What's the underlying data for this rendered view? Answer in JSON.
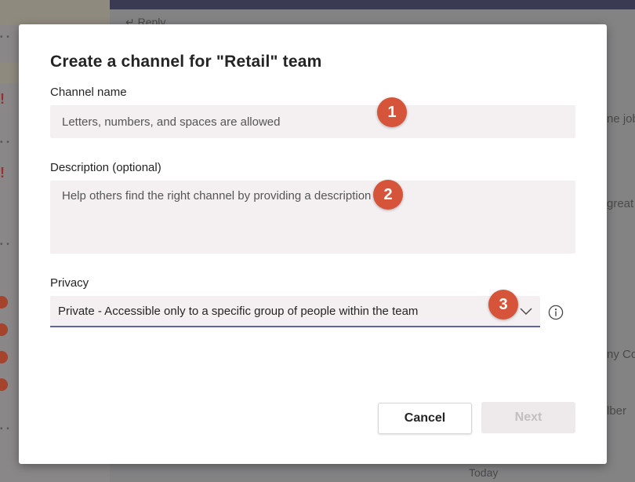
{
  "dialog": {
    "title": "Create a channel for \"Retail\" team",
    "channel_name": {
      "label": "Channel name",
      "value": "",
      "placeholder": "Letters, numbers, and spaces are allowed"
    },
    "description": {
      "label": "Description (optional)",
      "value": "",
      "placeholder": "Help others find the right channel by providing a description"
    },
    "privacy": {
      "label": "Privacy",
      "selected": "Private - Accessible only to a specific group of people within the team",
      "chevron_icon": "chevron-down-icon",
      "info_icon": "info-icon"
    },
    "buttons": {
      "cancel_label": "Cancel",
      "next_label": "Next"
    }
  },
  "callouts": [
    "1",
    "2",
    "3"
  ],
  "background": {
    "reply_label": "Reply",
    "snippets": [
      "ne job",
      "great",
      "ny Co",
      "lber",
      "Today"
    ]
  },
  "colors": {
    "accent": "#6264a7",
    "callout": "#d6553a",
    "input_bg": "#f4f0f2",
    "overlay": "#7e7e80"
  }
}
